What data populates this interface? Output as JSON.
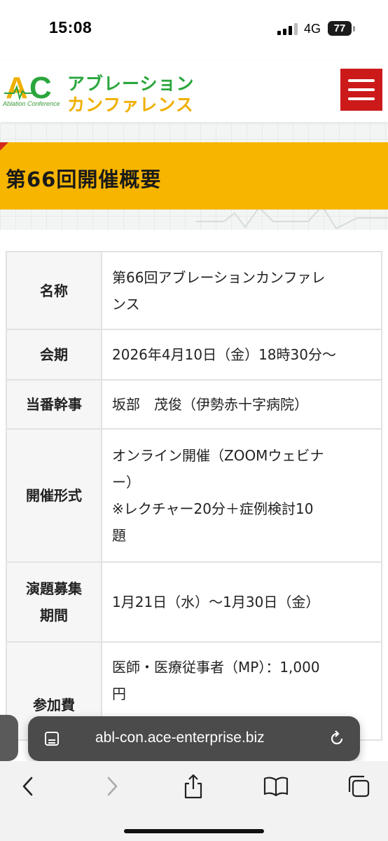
{
  "status_bar": {
    "time": "15:08",
    "network": "4G",
    "battery": "77"
  },
  "header": {
    "logo_text": "AC",
    "logo_subtitle": "Ablation Conference",
    "brand_line1": "アブレーション",
    "brand_line2": "カンファレンス",
    "menu_icon": "hamburger-icon",
    "colors": {
      "green": "#2aa63c",
      "yellow": "#f0b000",
      "menu_red": "#cc1a1a",
      "title_bar": "#f7b500"
    }
  },
  "page_title": "第66回開催概要",
  "info_rows": [
    {
      "label_lines": [
        "名称"
      ],
      "value_lines": [
        "第66回アブレーションカンファレ",
        "ンス"
      ]
    },
    {
      "label_lines": [
        "会期"
      ],
      "value_lines": [
        "2026年4月10日（金）18時30分〜"
      ]
    },
    {
      "label_lines": [
        "当番幹事"
      ],
      "value_lines": [
        "坂部　茂俊（伊勢赤十字病院）"
      ]
    },
    {
      "label_lines": [
        "開催形式"
      ],
      "value_lines": [
        "オンライン開催（ZOOMウェビナ",
        "ー）",
        "※レクチャー20分＋症例検討10",
        "題"
      ]
    },
    {
      "label_lines": [
        "演題募集",
        "期間"
      ],
      "value_lines": [
        "1月21日（水）〜1月30日（金）"
      ]
    },
    {
      "label_lines": [
        "参加費"
      ],
      "value_lines": [
        "医師・医療従事者（MP）：1,000",
        "円"
      ]
    }
  ],
  "browser": {
    "url": "abl-con.ace-enterprise.biz",
    "icons": [
      "reader-icon",
      "reload-icon",
      "back-icon",
      "forward-icon",
      "share-icon",
      "bookmarks-icon",
      "tabs-icon"
    ]
  }
}
